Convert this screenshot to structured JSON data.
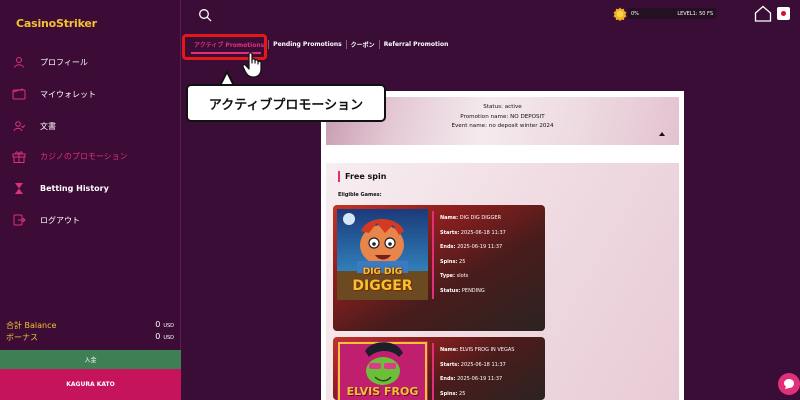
{
  "app": {
    "logo": "CasinoStriker"
  },
  "sidebar": {
    "items": [
      {
        "label": "プロフィール",
        "icon": "user-icon"
      },
      {
        "label": "マイウォレット",
        "icon": "wallet-icon"
      },
      {
        "label": "文書",
        "icon": "document-user-icon"
      },
      {
        "label": "カジノのプロモーション",
        "icon": "gift-icon",
        "active": true
      },
      {
        "label": "Betting History",
        "icon": "hourglass-icon"
      },
      {
        "label": "ログアウト",
        "icon": "logout-icon"
      }
    ],
    "balance": {
      "label": "合計 Balance",
      "value": "0",
      "currency": "USD"
    },
    "bonus": {
      "label": "ボーナス",
      "value": "0",
      "currency": "USD"
    },
    "deposit_label": "入金",
    "username": "KAGURA KATO"
  },
  "topbar": {
    "level_percent": "0%",
    "level_label": "LEVEL1: 50 FS",
    "level_progress": 0,
    "flag": "Japan"
  },
  "tabs": [
    {
      "label": "アクティブ Promotions",
      "active": true
    },
    {
      "label": "Pending Promotions"
    },
    {
      "label": "クーポン"
    },
    {
      "label": "Referral Promotion"
    }
  ],
  "callout": {
    "text": "アクティブプロモーション"
  },
  "promotion": {
    "status_label": "Status:",
    "status": "active",
    "name_label": "Promotion name:",
    "name": "NO DEPOSIT",
    "event_label": "Event name:",
    "event": "no deposit winter 2024"
  },
  "section": {
    "title": "Free spin",
    "eligible_label": "Eligible Games:"
  },
  "games": [
    {
      "thumb_text_1": "DIG DIG",
      "thumb_text_2": "DIGGER",
      "name_label": "Name:",
      "name": "DIG DIG DIGGER",
      "starts_label": "Starts:",
      "starts": "2025-06-18 11:37",
      "ends_label": "Ends:",
      "ends": "2025-06-19 11:37",
      "spins_label": "Spins:",
      "spins": "25",
      "type_label": "Type:",
      "type": "slots",
      "status_label": "Status:",
      "status": "PENDING"
    },
    {
      "thumb_text_1": "ELVIS FROG",
      "name_label": "Name:",
      "name": "ELVIS FROG IN VEGAS",
      "starts_label": "Starts:",
      "starts": "2025-06-18 11:37",
      "ends_label": "Ends:",
      "ends": "2025-06-19 11:37",
      "spins_label": "Spins:",
      "spins": "25"
    }
  ],
  "colors": {
    "accent": "#e0307a",
    "sidebar_bg": "#3c0c37",
    "logo": "#f2c230",
    "deposit": "#3e7f54",
    "user_bar": "#c5145c",
    "highlight": "#e41818"
  }
}
